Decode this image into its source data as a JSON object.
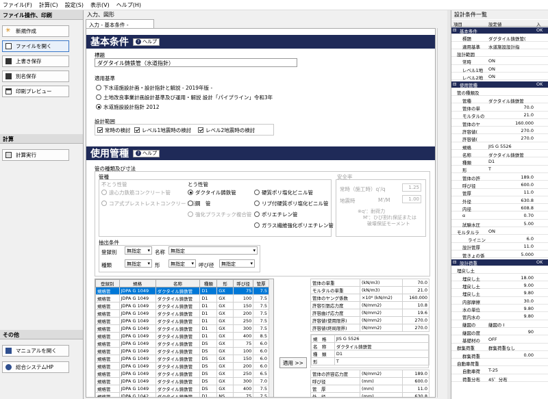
{
  "menu": [
    "ファイル(F)",
    "計算(C)",
    "設定(S)",
    "表示(V)",
    "ヘルプ(H)"
  ],
  "left": {
    "g1": "ファイル操作、印刷",
    "b1": "新規作成",
    "b2": "ファイルを開く",
    "b3": "上書き保存",
    "b4": "別名保存",
    "b5": "印刷プレビュー",
    "g2": "計算",
    "b6": "計算実行",
    "g3": "その他",
    "b7": "マニュアルを開く",
    "b8": "総合システムHP"
  },
  "center": {
    "title": "入力、図形",
    "tab": "入力 - 基本条件 -",
    "s1": "基本条件",
    "help": "ヘルプ",
    "title_label": "標題",
    "title_value": "ダグタイル鋳鉄管（水道指針）",
    "std_label": "適用基準",
    "std1": "下水道施設計画・設計指針と解説 - 2019年版 -",
    "std2": "土地改良事業計画設計基準及び運用・解説 設計「パイプライン」令和3年",
    "std3": "水道施設設計指針 2012",
    "range_label": "設計範囲",
    "chk1": "常時の検討",
    "chk2": "レベル1地震時の検討",
    "chk3": "レベル2地震時の検討",
    "s2": "使用管種",
    "pipe_group": "管の種類及び寸法",
    "kind": "管種",
    "fu": "不とう性管",
    "fu1": "遠心力鉄筋コンクリート管",
    "fu2": "コア式プレストレストコンクリート管",
    "tou": "とう性管",
    "t1": "ダクタイル鋳鉄管",
    "t2": "鋼　管",
    "t3": "強化プラスチック複合管",
    "t4": "硬質ポリ塩化ビニル管",
    "t5": "リブ付硬質ポリ塩化ビニル管",
    "t6": "ポリエチレン管",
    "t7": "ガラス繊維強化ポリエチレン管",
    "safe": "安全率",
    "safe1": "常時（施工時）q'/q",
    "safe1v": "1.25",
    "safe2": "地震時",
    "safe2u": "M'/M",
    "safe2v": "1.00",
    "note1": "※q'：耐荷力",
    "note2": "M'：ひび割れ保証または",
    "note3": "破壊保証モーメント",
    "extract": "抽出条件",
    "reg": "登録別",
    "reg_v": "無指定",
    "name": "名称",
    "name_v": "無指定",
    "kind2": "種類",
    "kind2_v": "無指定",
    "form": "形",
    "form_v": "無指定",
    "dia": "呼び径",
    "dia_v": "無指定",
    "cols": [
      "登録別",
      "規格",
      "名称",
      "種類",
      "形",
      "呼び径",
      "管厚"
    ],
    "rows": [
      [
        "規格管",
        "JDPA G 1049",
        "ダクタイル鋳鉄管",
        "D1",
        "GX",
        "75",
        "7.5"
      ],
      [
        "規格管",
        "JDPA G 1049",
        "ダクタイル鋳鉄管",
        "D1",
        "GX",
        "100",
        "7.5"
      ],
      [
        "規格管",
        "JDPA G 1049",
        "ダクタイル鋳鉄管",
        "D1",
        "GX",
        "150",
        "7.5"
      ],
      [
        "規格管",
        "JDPA G 1049",
        "ダクタイル鋳鉄管",
        "D1",
        "GX",
        "200",
        "7.5"
      ],
      [
        "規格管",
        "JDPA G 1049",
        "ダクタイル鋳鉄管",
        "D1",
        "GX",
        "250",
        "7.5"
      ],
      [
        "規格管",
        "JDPA G 1049",
        "ダクタイル鋳鉄管",
        "D1",
        "GX",
        "300",
        "7.5"
      ],
      [
        "規格管",
        "JDPA G 1049",
        "ダクタイル鋳鉄管",
        "D1",
        "GX",
        "400",
        "8.5"
      ],
      [
        "規格管",
        "JDPA G 1049",
        "ダクタイル鋳鉄管",
        "DS",
        "GX",
        "75",
        "6.0"
      ],
      [
        "規格管",
        "JDPA G 1049",
        "ダクタイル鋳鉄管",
        "DS",
        "GX",
        "100",
        "6.0"
      ],
      [
        "規格管",
        "JDPA G 1049",
        "ダクタイル鋳鉄管",
        "DS",
        "GX",
        "150",
        "6.0"
      ],
      [
        "規格管",
        "JDPA G 1049",
        "ダクタイル鋳鉄管",
        "DS",
        "GX",
        "200",
        "6.0"
      ],
      [
        "規格管",
        "JDPA G 1049",
        "ダクタイル鋳鉄管",
        "DS",
        "GX",
        "250",
        "6.5"
      ],
      [
        "規格管",
        "JDPA G 1049",
        "ダクタイル鋳鉄管",
        "DS",
        "GX",
        "300",
        "7.0"
      ],
      [
        "規格管",
        "JDPA G 1049",
        "ダクタイル鋳鉄管",
        "DS",
        "GX",
        "400",
        "7.5"
      ],
      [
        "規格管",
        "JDPA G 1042",
        "ダクタイル鋳鉄管",
        "D1",
        "NS",
        "75",
        "7.5"
      ]
    ],
    "props": [
      [
        "管体の単重",
        "(kN/m3)",
        "70.0"
      ],
      [
        "モルタルの単重",
        "(kN/m3)",
        "21.0"
      ],
      [
        "管体のヤング係数",
        "×10⁶ (kN/m2)",
        "160.000"
      ],
      [
        "許容引張応力度",
        "(N/mm2)",
        "10.8"
      ],
      [
        "許容曲げ応力度",
        "(N/mm2)",
        "19.6"
      ],
      [
        "許容値(使用限界)",
        "(N/mm2)",
        "270.0"
      ],
      [
        "許容値(終局限界)",
        "(N/mm2)",
        "270.0"
      ]
    ],
    "spec": [
      [
        "規　格",
        "JIS G 5526"
      ],
      [
        "名　称",
        "ダクタイル鋳鉄管"
      ],
      [
        "種　類",
        "D1"
      ],
      [
        "形",
        "T"
      ]
    ],
    "apply": "適用 >>",
    "props2": [
      [
        "管体の許容応力度",
        "(N/mm2)",
        "189.0"
      ],
      [
        "呼び径",
        "(mm)",
        "600.0"
      ],
      [
        "管　厚",
        "(mm)",
        "11.0"
      ],
      [
        "外　径",
        "(mm)",
        "630.8"
      ]
    ]
  },
  "right": {
    "title": "設計条件一覧",
    "h1": "項目",
    "h2": "設定値",
    "h3": "入",
    "rows": [
      {
        "s": 1,
        "a": "基本条件",
        "b": "",
        "c": "OK"
      },
      {
        "i": 2,
        "a": "標題",
        "b": "ダグタイル鋳鉄管("
      },
      {
        "i": 2,
        "a": "適用基準",
        "b": "水道施設設計指"
      },
      {
        "i": 1,
        "a": "設計範囲",
        "b": ""
      },
      {
        "i": 2,
        "a": "常時",
        "b": "ON"
      },
      {
        "i": 2,
        "a": "レベル1地",
        "b": "ON"
      },
      {
        "i": 2,
        "a": "レベル2地",
        "b": "ON"
      },
      {
        "s": 1,
        "a": "使用管種",
        "b": "",
        "c": "OK"
      },
      {
        "i": 1,
        "a": "管の種類及",
        "b": ""
      },
      {
        "i": 2,
        "a": "管種",
        "b": "ダクタイル鋳鉄管"
      },
      {
        "i": 2,
        "a": "管体の単",
        "b": "70.0"
      },
      {
        "i": 2,
        "a": "モルタルの",
        "b": "21.0"
      },
      {
        "i": 2,
        "a": "管体のヤ",
        "b": "160.000"
      },
      {
        "i": 2,
        "a": "許容値(",
        "b": "270.0"
      },
      {
        "i": 2,
        "a": "許容値(",
        "b": "270.0"
      },
      {
        "i": 2,
        "a": "規格",
        "b": "JIS G 5526"
      },
      {
        "i": 2,
        "a": "名称",
        "b": "ダクタイル鋳鉄管"
      },
      {
        "i": 2,
        "a": "種類",
        "b": "D1"
      },
      {
        "i": 2,
        "a": "形",
        "b": "T"
      },
      {
        "i": 2,
        "a": "管体の許",
        "b": "189.0"
      },
      {
        "i": 2,
        "a": "呼び径",
        "b": "600.0"
      },
      {
        "i": 2,
        "a": "管厚",
        "b": "11.0"
      },
      {
        "i": 2,
        "a": "外径",
        "b": "630.8"
      },
      {
        "i": 2,
        "a": "内径",
        "b": "608.8"
      },
      {
        "i": 2,
        "a": "α",
        "b": "0.70"
      },
      {
        "i": 2,
        "a": "試験水圧",
        "b": "5.00"
      },
      {
        "i": 1,
        "a": "モルタルラ",
        "b": "ON"
      },
      {
        "i": 3,
        "a": "ライニン",
        "b": "6.0"
      },
      {
        "i": 2,
        "a": "設計管厚",
        "b": "11.0"
      },
      {
        "i": 2,
        "a": "管きょの係",
        "b": "5.000"
      },
      {
        "s": 1,
        "a": "設計荷重",
        "b": "",
        "c": "OK"
      },
      {
        "i": 1,
        "a": "埋戻し土",
        "b": ""
      },
      {
        "i": 2,
        "a": "埋戻し土",
        "b": "18.00"
      },
      {
        "i": 2,
        "a": "埋戻し土",
        "b": "9.00"
      },
      {
        "i": 2,
        "a": "埋戻し土",
        "b": "9.80"
      },
      {
        "i": 2,
        "a": "内部摩擦",
        "b": "30.0"
      },
      {
        "i": 2,
        "a": "水の単位",
        "b": "9.80"
      },
      {
        "i": 2,
        "a": "管内水の",
        "b": "9.80"
      },
      {
        "i": 2,
        "a": "継図の",
        "b": "継図の I"
      },
      {
        "i": 2,
        "a": "継図の度",
        "b": "90"
      },
      {
        "i": 2,
        "a": "基礎材の",
        "b": "OFF"
      },
      {
        "i": 1,
        "a": "群集荷重",
        "b": "群集荷重なし"
      },
      {
        "i": 2,
        "a": "群集荷重",
        "b": "0.00"
      },
      {
        "i": 1,
        "a": "自動車荷重",
        "b": ""
      },
      {
        "i": 2,
        "a": "自動車荷",
        "b": "T-25"
      },
      {
        "i": 2,
        "a": "荷重分布",
        "b": "45゜分布"
      }
    ]
  }
}
